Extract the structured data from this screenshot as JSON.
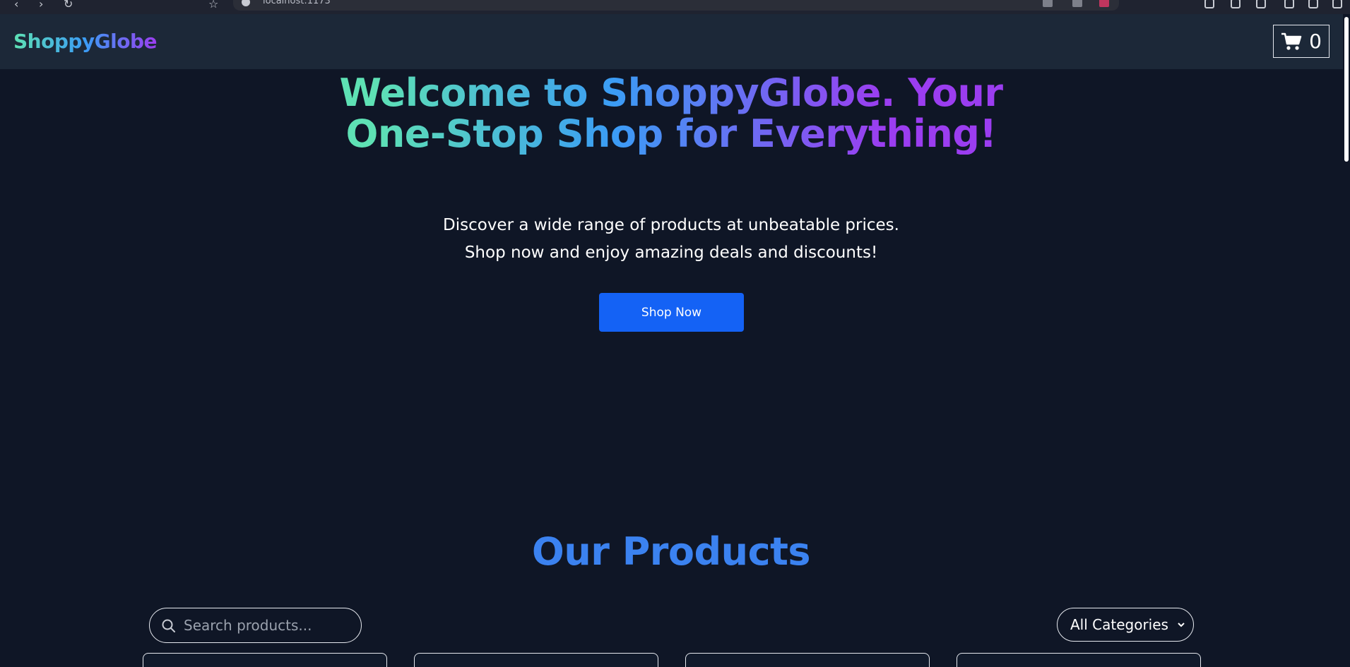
{
  "browser": {
    "url": "localhost:1173"
  },
  "header": {
    "logo": "ShoppyGlobe",
    "cart_count": "0"
  },
  "hero": {
    "title": "Welcome to ShoppyGlobe. Your One-Stop Shop for Everything!",
    "subtitle_line1": "Discover a wide range of products at unbeatable prices.",
    "subtitle_line2": "Shop now and enjoy amazing deals and discounts!",
    "cta_label": "Shop Now"
  },
  "products": {
    "title": "Our Products",
    "search_placeholder": "Search products...",
    "category_selected": "All Categories",
    "card_count_visible": 4
  },
  "colors": {
    "background": "#0f1626",
    "header_bg": "#1c2838",
    "accent": "#1462f5",
    "gradient_start": "#5ee1b4",
    "gradient_mid": "#3b9cf5",
    "gradient_end": "#9b3df0",
    "products_title": "#3b82f0"
  }
}
